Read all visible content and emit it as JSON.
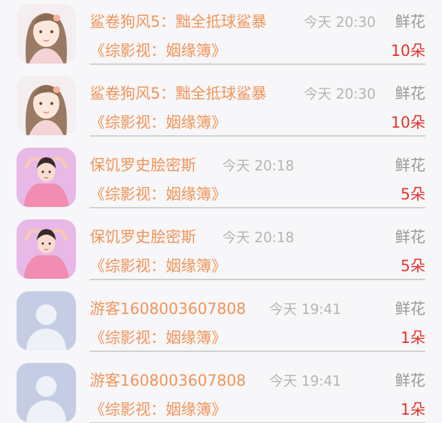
{
  "rows": [
    {
      "name": "鲨卷狗风5：黜全抵球鲨暴",
      "time": "今天 20:30",
      "gift": "鲜花",
      "book": "《综影视：姻缘簿》",
      "count": "10朵",
      "avatar": "girl-avatar"
    },
    {
      "name": "鲨卷狗风5：黜全抵球鲨暴",
      "time": "今天 20:30",
      "gift": "鲜花",
      "book": "《综影视：姻缘簿》",
      "count": "10朵",
      "avatar": "girl-avatar"
    },
    {
      "name": "保饥罗史脍密斯",
      "time": "今天 20:18",
      "gift": "鲜花",
      "book": "《综影视：姻缘簿》",
      "count": "5朵",
      "avatar": "pink-girl-avatar"
    },
    {
      "name": "保饥罗史脍密斯",
      "time": "今天 20:18",
      "gift": "鲜花",
      "book": "《综影视：姻缘簿》",
      "count": "5朵",
      "avatar": "pink-girl-avatar"
    },
    {
      "name": "游客1608003607808",
      "time": "今天 19:41",
      "gift": "鲜花",
      "book": "《综影视：姻缘簿》",
      "count": "1朵",
      "avatar": "default-user-avatar"
    },
    {
      "name": "游客1608003607808",
      "time": "今天 19:41",
      "gift": "鲜花",
      "book": "《综影视：姻缘簿》",
      "count": "1朵",
      "avatar": "default-user-avatar"
    }
  ],
  "colors": {
    "name": "#f0955a",
    "count": "#e4322b",
    "time": "#b5b5b5",
    "gift": "#9a9a9a",
    "background": "#f7f6f8"
  }
}
